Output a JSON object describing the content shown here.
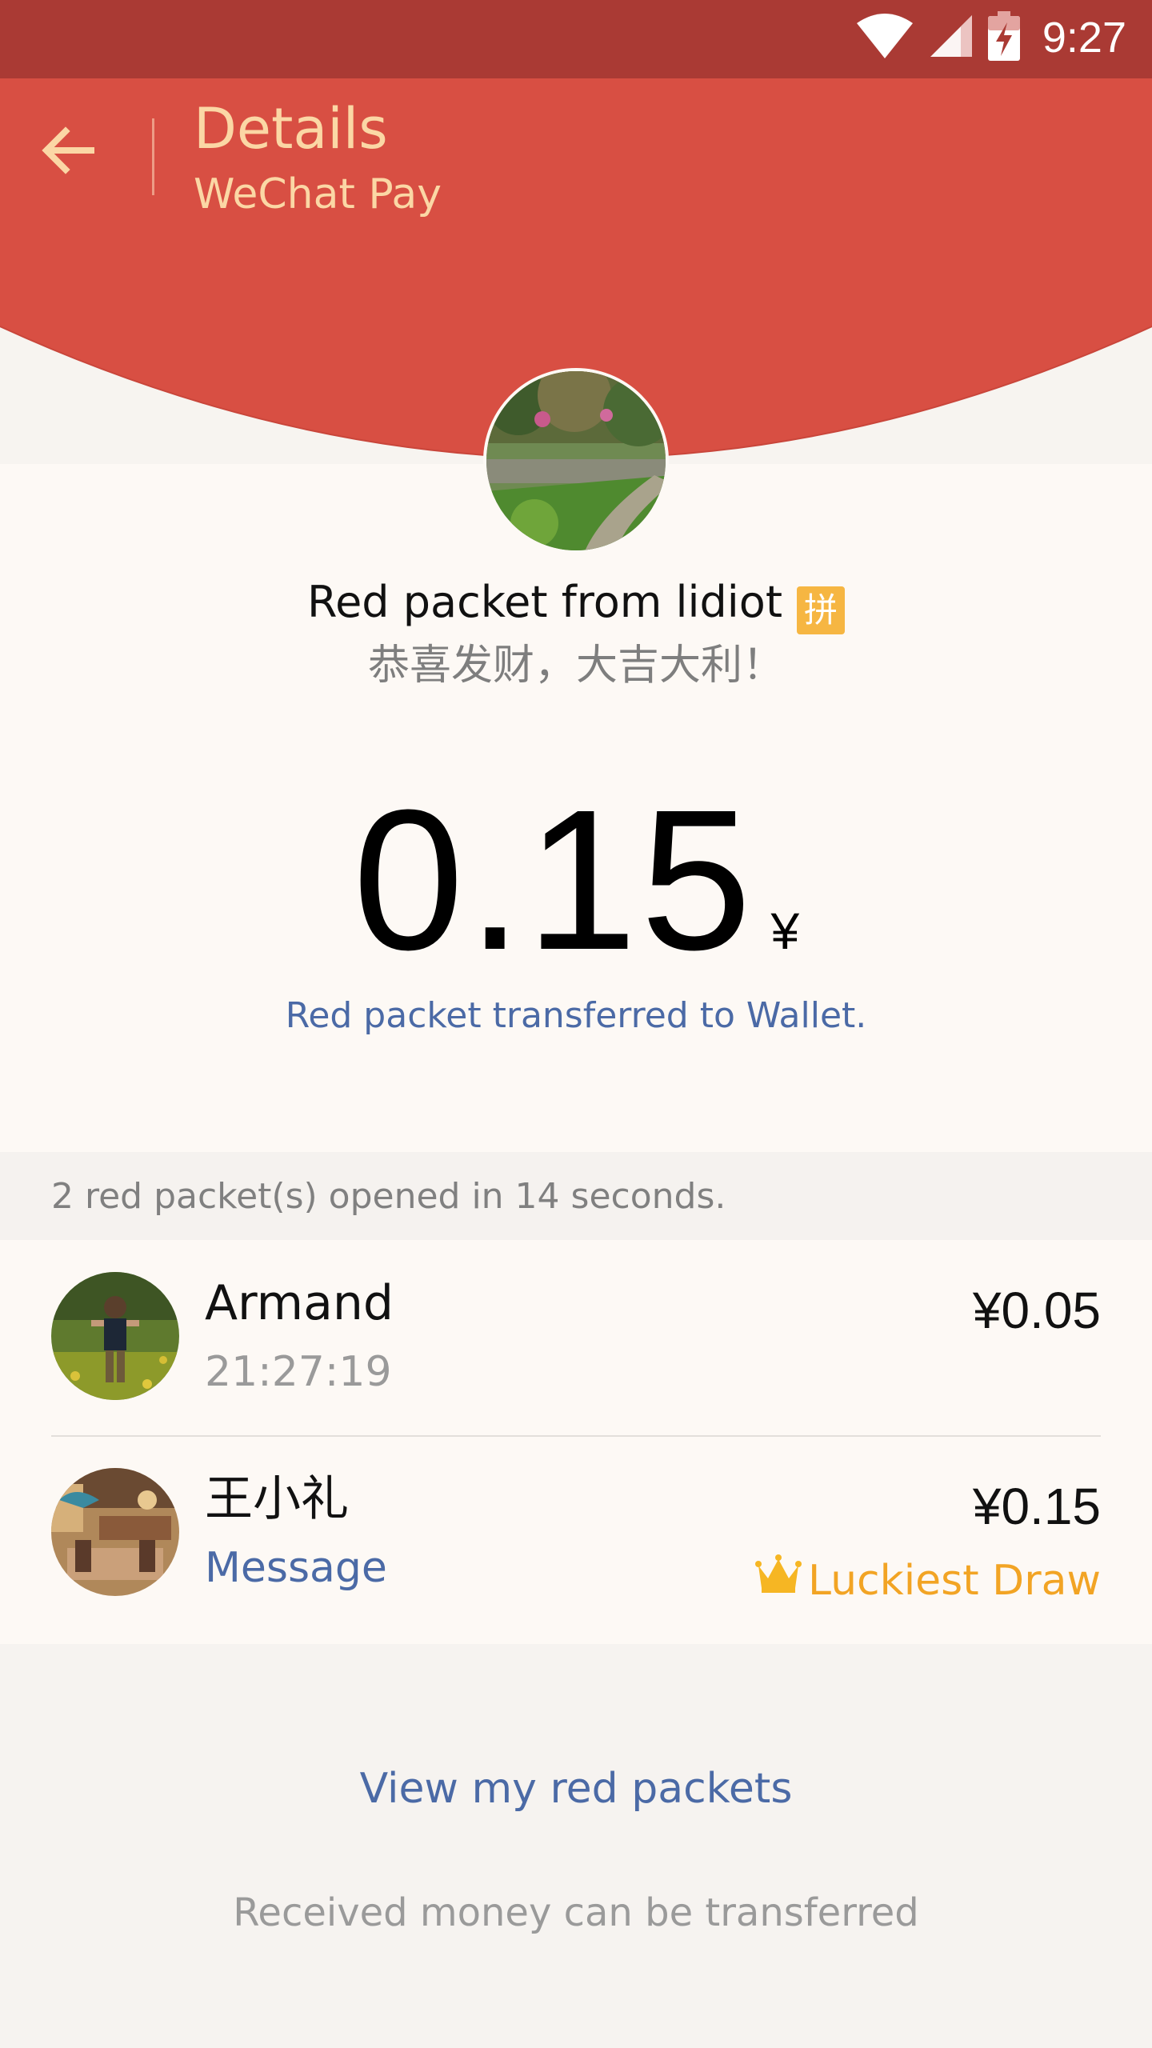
{
  "status_bar": {
    "time": "9:27",
    "icons": [
      "wifi-icon",
      "signal-icon",
      "battery-charging-icon"
    ]
  },
  "header": {
    "title": "Details",
    "subtitle": "WeChat Pay",
    "back_icon": "arrow-left-icon"
  },
  "packet": {
    "sender_line": "Red packet from lidiot",
    "badge": "拼",
    "greeting": "恭喜发财，大吉大利！",
    "amount": "0.15",
    "currency": "¥",
    "wallet_status": "Red packet transferred to Wallet."
  },
  "summary": {
    "text": "2 red packet(s) opened in 14 seconds."
  },
  "recipients": [
    {
      "name": "Armand",
      "detail": "21:27:19",
      "amount": "¥0.05"
    },
    {
      "name": "王小礼",
      "detail": "Message",
      "amount": "¥0.15",
      "badge": "Luckiest Draw",
      "badge_icon": "crown-icon"
    }
  ],
  "footer": {
    "view_link": "View my red packets",
    "note": "Received money can be transferred"
  },
  "colors": {
    "status_bar": "#aa3a34",
    "header_red": "#d84f43",
    "header_text": "#fbd7a5",
    "link_blue": "#4b6aa6",
    "gold": "#f2a424"
  }
}
